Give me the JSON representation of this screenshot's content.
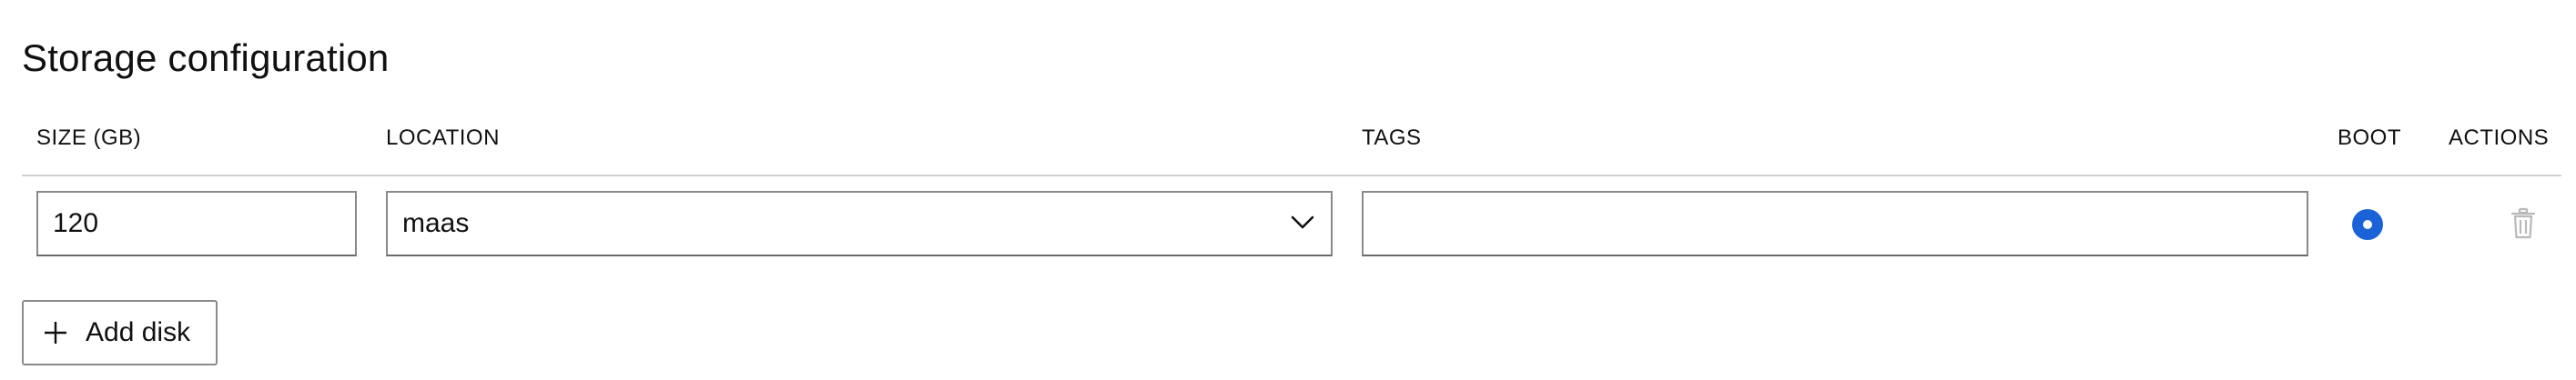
{
  "section": {
    "title": "Storage configuration"
  },
  "table": {
    "columns": {
      "size": "SIZE (GB)",
      "location": "LOCATION",
      "tags": "TAGS",
      "boot": "BOOT",
      "actions": "ACTIONS"
    },
    "rows": [
      {
        "size": "120",
        "location": "maas",
        "tags": "",
        "boot_selected": true
      }
    ]
  },
  "actions": {
    "add_disk_label": "Add disk"
  },
  "icons": {
    "location_dropdown": "chevron-down-icon",
    "delete": "trash-icon",
    "add": "plus-icon"
  },
  "colors": {
    "accent": "#1b62d9",
    "border": "#8a8a8a",
    "disabled_icon": "#b9b9b9"
  }
}
